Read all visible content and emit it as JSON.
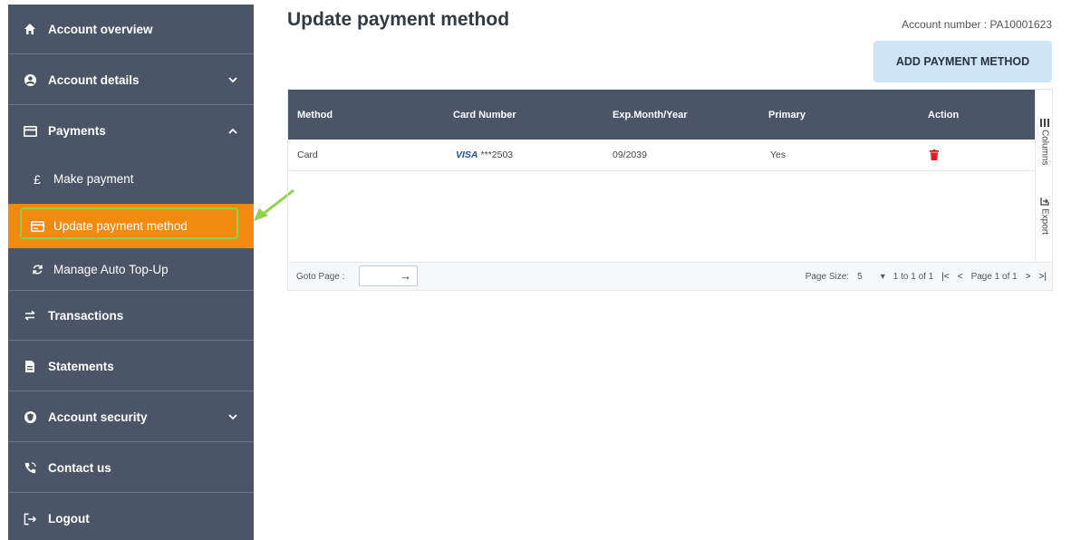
{
  "sidebar": {
    "account_overview": "Account overview",
    "account_details": "Account details",
    "payments": "Payments",
    "make_payment": "Make payment",
    "update_payment_method": "Update payment method",
    "manage_auto_topup": "Manage Auto Top-Up",
    "transactions": "Transactions",
    "statements": "Statements",
    "account_security": "Account security",
    "contact_us": "Contact us",
    "logout": "Logout"
  },
  "page": {
    "title": "Update payment method",
    "account_number": "Account number : PA10001623",
    "add_button": "ADD PAYMENT METHOD"
  },
  "grid": {
    "columns": [
      "Method",
      "Card Number",
      "Exp.Month/Year",
      "Primary",
      "Action"
    ],
    "rows": [
      {
        "method": "Card",
        "card_brand": "VISA",
        "card_number": "***2503",
        "exp": "09/2039",
        "primary": "Yes"
      }
    ],
    "tools": {
      "columns": "Columns",
      "export": "Export"
    },
    "footer": {
      "goto_label": "Goto Page :",
      "page_size_label": "Page Size:",
      "page_size": "5",
      "range": "1 to 1 of 1",
      "page_of": "Page 1 of 1"
    }
  },
  "colors": {
    "sidebar": "#4a5668",
    "active": "#f28a10",
    "accent_button": "#cfe5f6",
    "highlight": "#8fd14f",
    "delete": "#e02020"
  },
  "icons": [
    "home-icon",
    "user-circle-icon",
    "card-icon",
    "pound-icon",
    "card-icon",
    "refresh-icon",
    "swap-icon",
    "document-icon",
    "shield-icon",
    "phone-icon",
    "logout-icon",
    "trash-icon",
    "columns-icon",
    "export-icon"
  ]
}
